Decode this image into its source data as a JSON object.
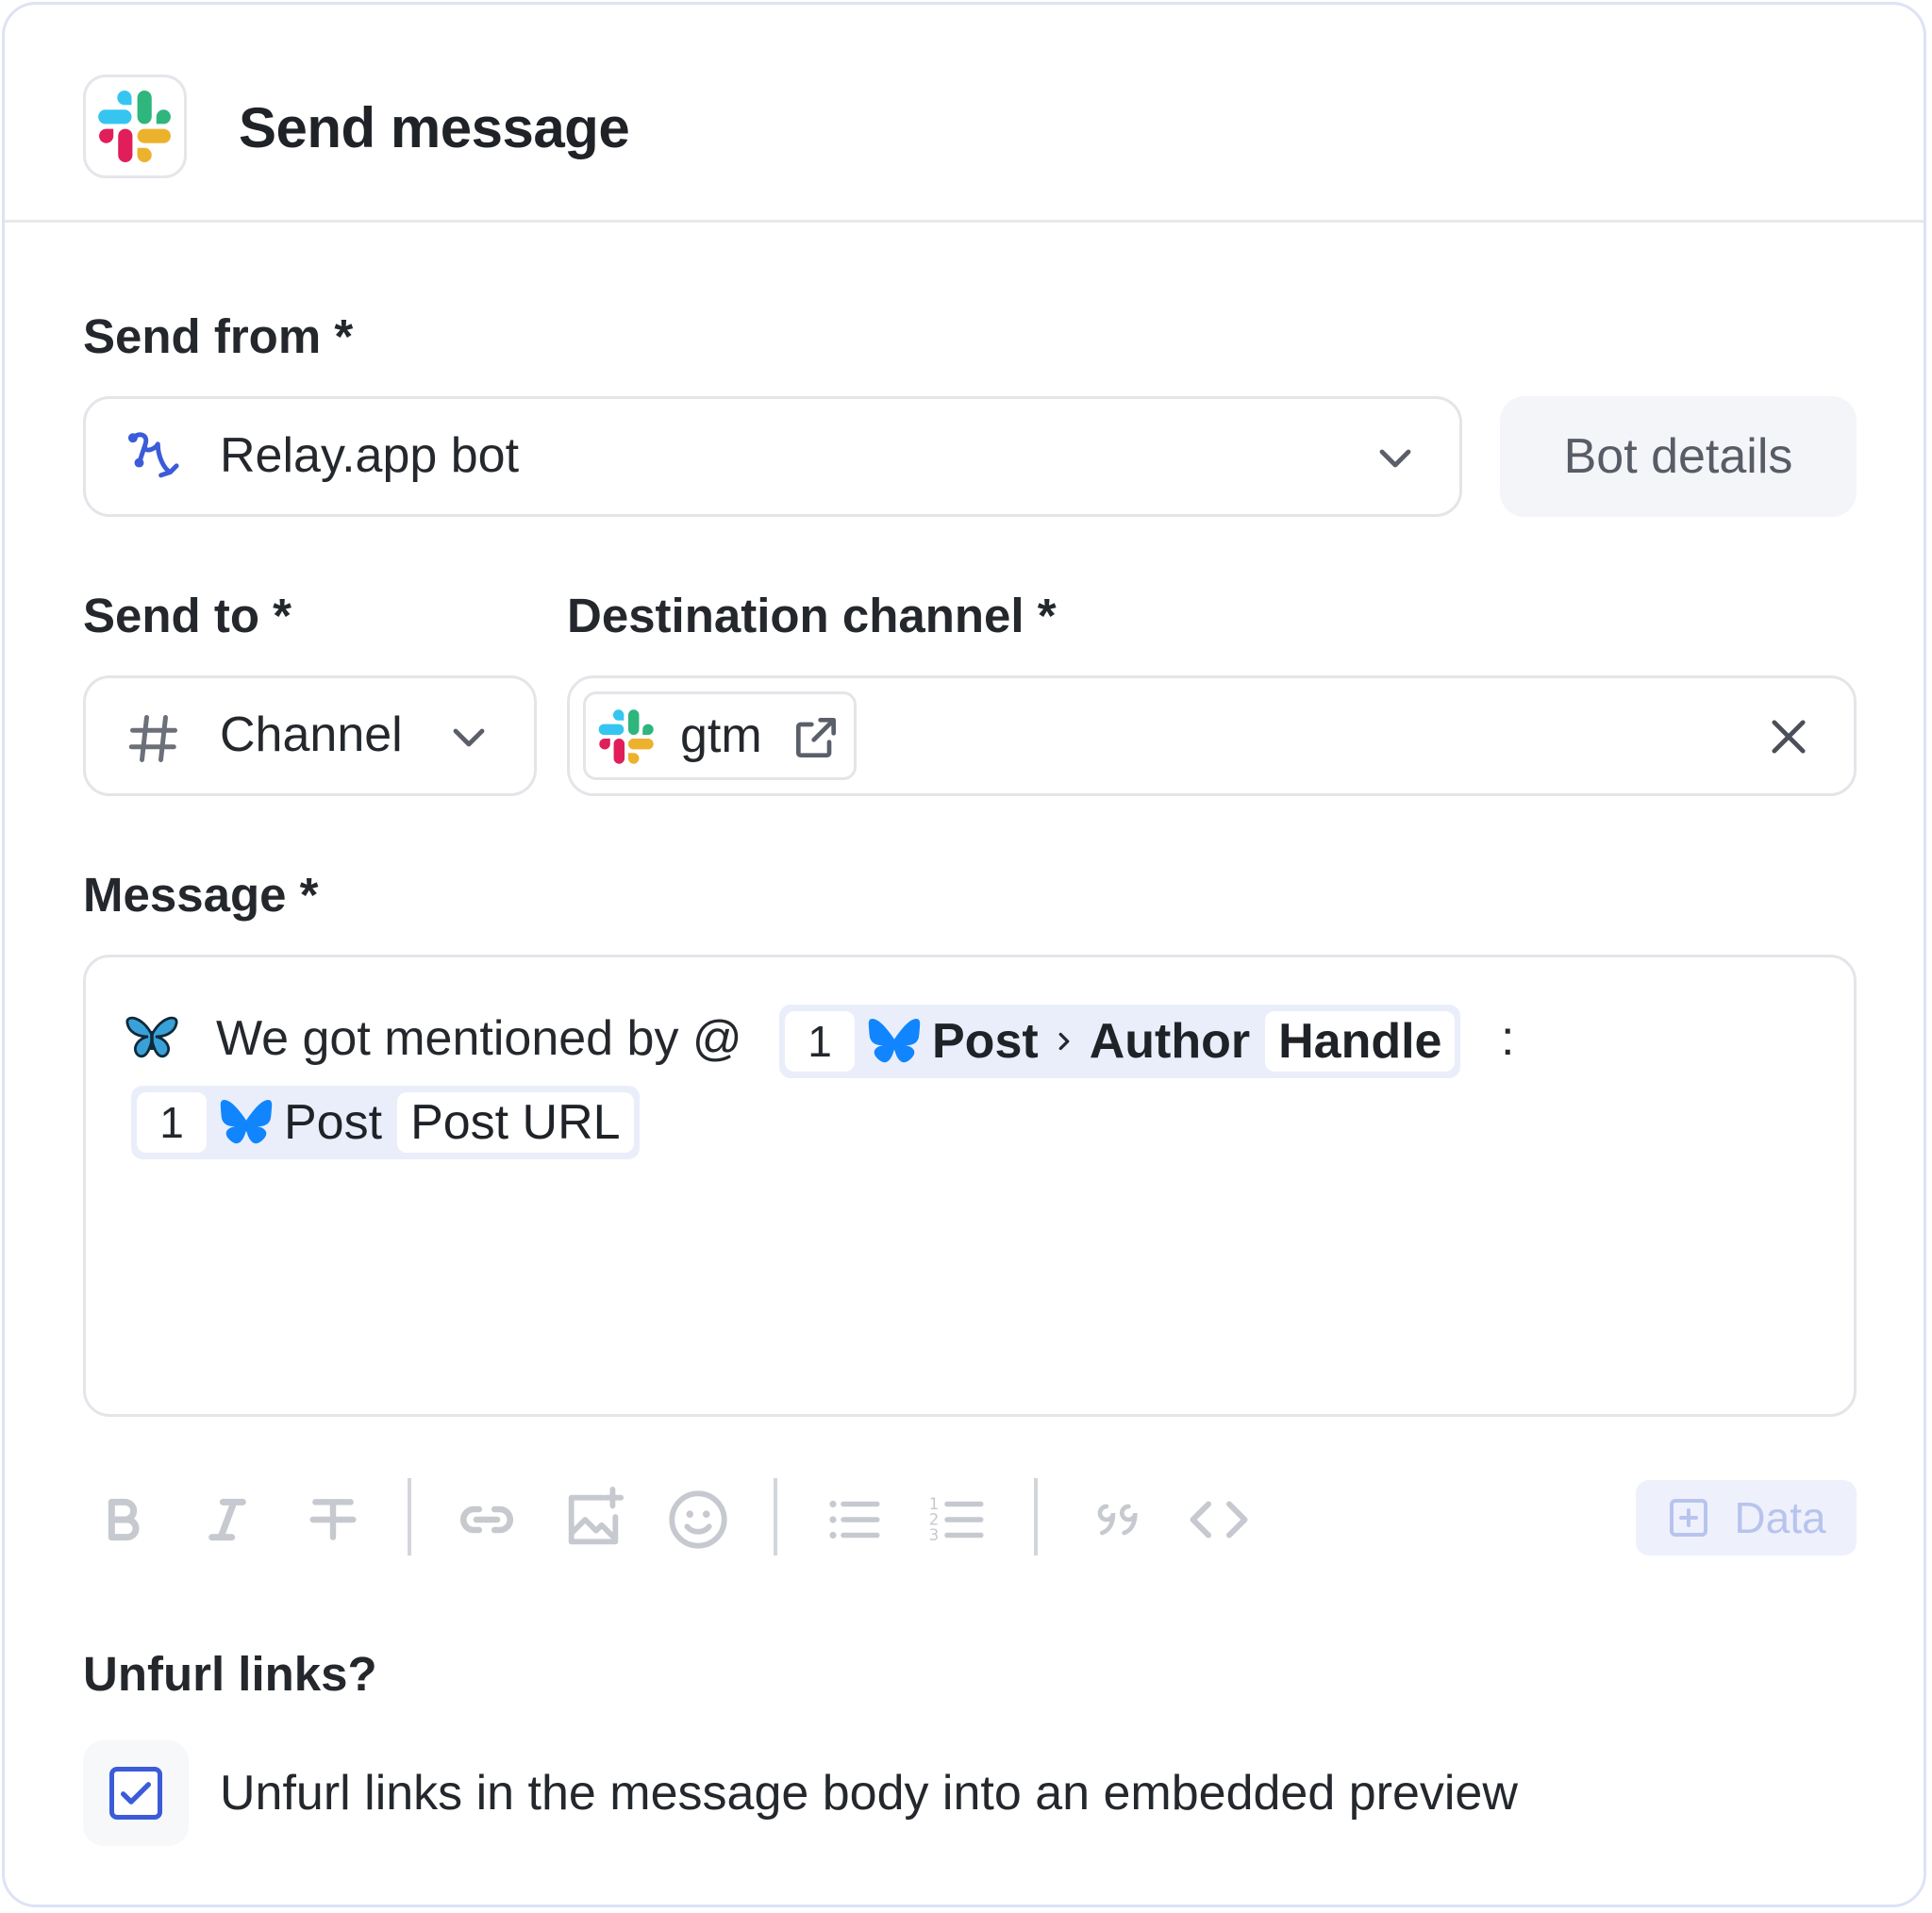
{
  "header": {
    "title": "Send message",
    "app_icon": "slack-icon"
  },
  "send_from": {
    "label": "Send from *",
    "value": "Relay.app bot",
    "icon": "relay-bot-icon",
    "bot_details_label": "Bot details"
  },
  "send_to": {
    "label": "Send to *",
    "value": "Channel",
    "icon": "hash-icon"
  },
  "destination": {
    "label": "Destination channel *",
    "channel": "gtm",
    "icon": "slack-icon"
  },
  "message": {
    "label": "Message *",
    "prefix_text": "We got mentioned by @",
    "token1": {
      "step": "1",
      "source": "Post",
      "path": "Author",
      "field": "Handle"
    },
    "suffix_text": ":",
    "token2": {
      "step": "1",
      "source": "Post",
      "field": "Post URL"
    }
  },
  "toolbar": {
    "items": [
      "bold-icon",
      "italic-icon",
      "strikethrough-icon",
      "link-icon",
      "image-icon",
      "emoji-icon",
      "bullet-list-icon",
      "numbered-list-icon",
      "quote-icon",
      "code-icon"
    ],
    "data_label": "Data"
  },
  "unfurl": {
    "label": "Unfurl links?",
    "checkbox_label": "Unfurl links in the message body into an embedded preview",
    "checked": true
  },
  "colors": {
    "accent": "#3b5bd9",
    "bluesky": "#1185fe",
    "chip_bg": "#eaeefb"
  }
}
